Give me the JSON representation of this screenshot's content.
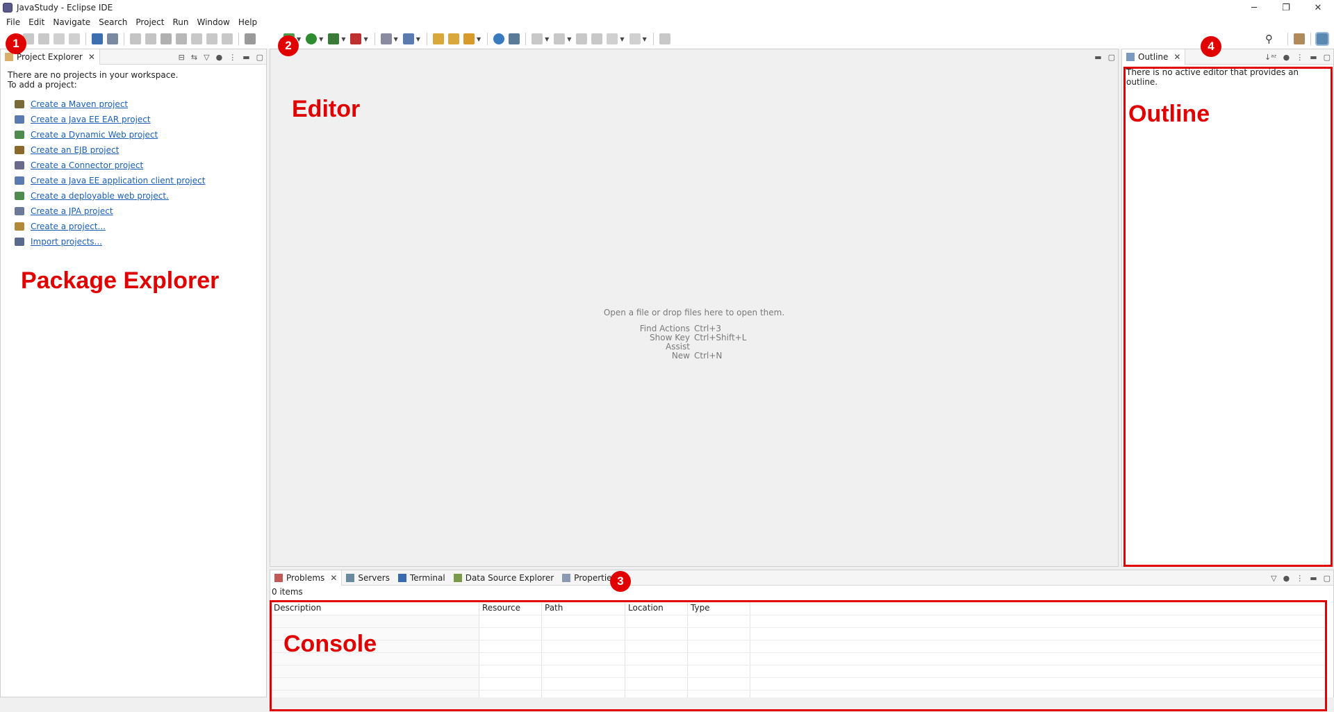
{
  "window": {
    "title": "JavaStudy - Eclipse IDE",
    "controls": [
      "─",
      "❐",
      "✕"
    ]
  },
  "menu": [
    "File",
    "Edit",
    "Navigate",
    "Search",
    "Project",
    "Run",
    "Window",
    "Help"
  ],
  "project_explorer": {
    "tab_label": "Project Explorer",
    "message_line1": "There are no projects in your workspace.",
    "message_line2": "To add a project:",
    "links": [
      {
        "label": "Create a Maven project",
        "icon": "maven-project-icon",
        "color": "#7a6a3a"
      },
      {
        "label": "Create a Java EE EAR project",
        "icon": "ear-project-icon",
        "color": "#5a7ab0"
      },
      {
        "label": "Create a Dynamic Web project",
        "icon": "web-project-icon",
        "color": "#4f8a4f"
      },
      {
        "label": "Create an EJB project",
        "icon": "ejb-project-icon",
        "color": "#8a6a2a"
      },
      {
        "label": "Create a Connector project",
        "icon": "connector-project-icon",
        "color": "#6a6a8a"
      },
      {
        "label": "Create a Java EE application client project",
        "icon": "appclient-project-icon",
        "color": "#5a7ab0"
      },
      {
        "label": "Create a deployable web project.",
        "icon": "deployable-web-icon",
        "color": "#4f8a4f"
      },
      {
        "label": "Create a JPA project",
        "icon": "jpa-project-icon",
        "color": "#6a7a9a"
      },
      {
        "label": "Create a project...",
        "icon": "new-project-icon",
        "color": "#b08a3a"
      },
      {
        "label": "Import projects...",
        "icon": "import-projects-icon",
        "color": "#5a6a8a"
      }
    ]
  },
  "editor": {
    "empty_hint": "Open a file or drop files here to open them.",
    "shortcuts": [
      {
        "action": "Find Actions",
        "key": "Ctrl+3"
      },
      {
        "action": "Show Key Assist",
        "key": "Ctrl+Shift+L"
      },
      {
        "action": "New",
        "key": "Ctrl+N"
      }
    ]
  },
  "outline": {
    "tab_label": "Outline",
    "message": "There is no active editor that provides an outline."
  },
  "bottom_panel": {
    "tabs": [
      "Problems",
      "Servers",
      "Terminal",
      "Data Source Explorer",
      "Properties"
    ],
    "items_count": "0 items",
    "columns": [
      "Description",
      "Resource",
      "Path",
      "Location",
      "Type"
    ]
  },
  "annotations": {
    "badges": [
      "1",
      "2",
      "3",
      "4"
    ],
    "labels": {
      "package_explorer": "Package Explorer",
      "editor": "Editor",
      "outline": "Outline",
      "console": "Console"
    },
    "color": "#e10000"
  }
}
